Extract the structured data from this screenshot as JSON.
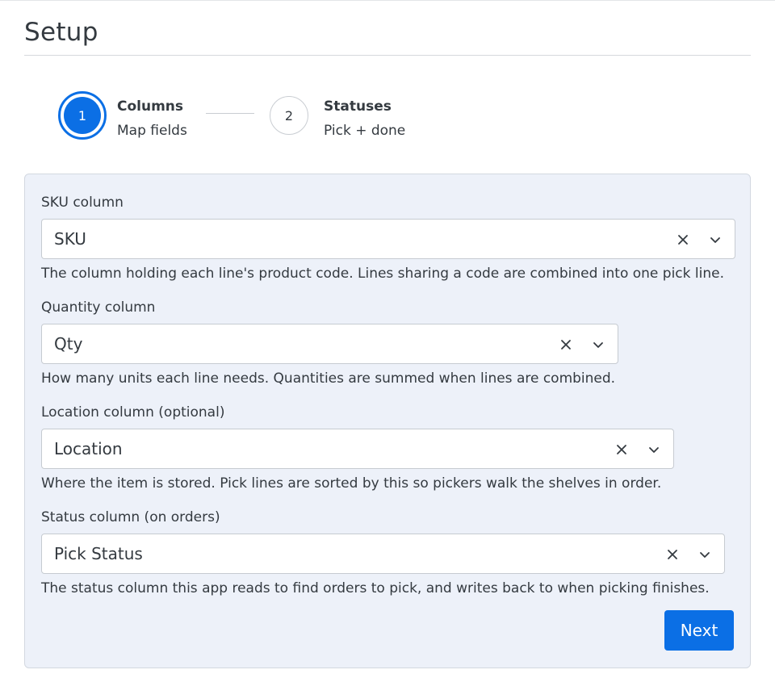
{
  "page": {
    "title": "Setup"
  },
  "stepper": {
    "steps": [
      {
        "number": "1",
        "title": "Columns",
        "subtitle": "Map fields",
        "state": "active"
      },
      {
        "number": "2",
        "title": "Statuses",
        "subtitle": "Pick + done",
        "state": "inactive"
      }
    ]
  },
  "form": {
    "fields": [
      {
        "label": "SKU column",
        "value": "SKU",
        "help": "The column holding each line's product code. Lines sharing a code are combined into one pick line."
      },
      {
        "label": "Quantity column",
        "value": "Qty",
        "help": "How many units each line needs. Quantities are summed when lines are combined."
      },
      {
        "label": "Location column (optional)",
        "value": "Location",
        "help": "Where the item is stored. Pick lines are sorted by this so pickers walk the shelves in order."
      },
      {
        "label": "Status column (on orders)",
        "value": "Pick Status",
        "help": "The status column this app reads to find orders to pick, and writes back to when picking finishes."
      }
    ],
    "next_label": "Next"
  },
  "colors": {
    "accent": "#0b6fe5",
    "panel_bg": "#edf1f9"
  },
  "icons": {
    "clear": "close-icon",
    "dropdown": "chevron-down-icon"
  }
}
